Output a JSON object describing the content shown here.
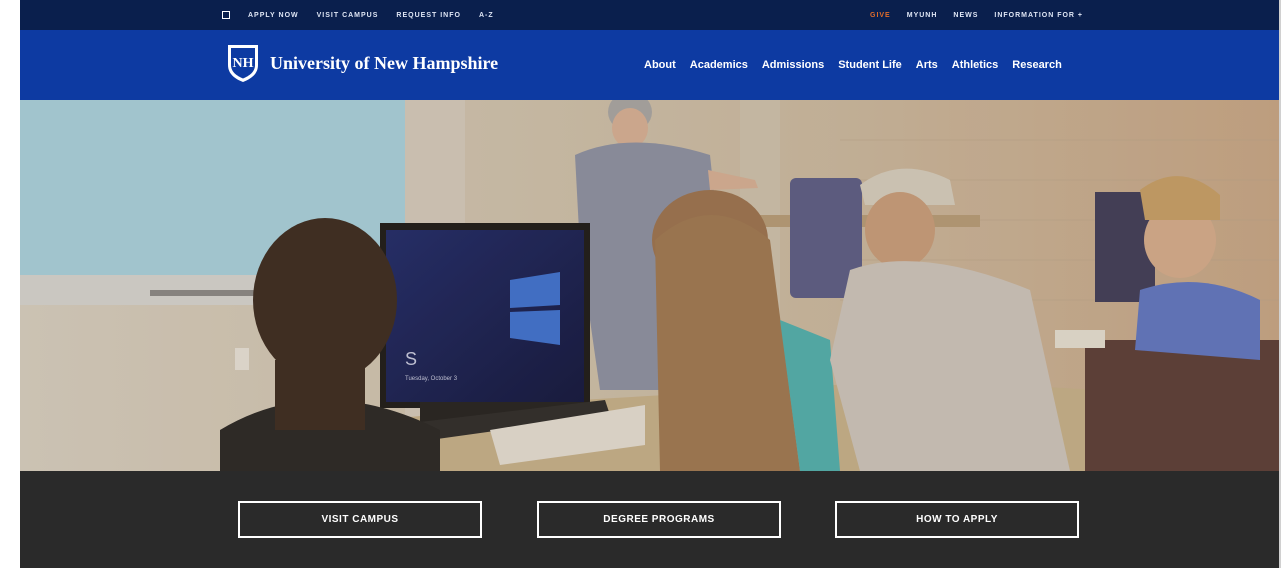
{
  "utility_nav": {
    "left": [
      "APPLY NOW",
      "VISIT CAMPUS",
      "REQUEST INFO",
      "A-Z"
    ],
    "right": [
      "GIVE",
      "MYUNH",
      "NEWS",
      "INFORMATION FOR +"
    ]
  },
  "header": {
    "logo_letters": "NH",
    "site_name": "University of New Hampshire",
    "nav": [
      "About",
      "Academics",
      "Admissions",
      "Student Life",
      "Arts",
      "Athletics",
      "Research"
    ]
  },
  "hero": {
    "screen_text": "S",
    "screen_subtext": "Tuesday, October 3"
  },
  "cta": [
    "VISIT CAMPUS",
    "DEGREE PROGRAMS",
    "HOW TO APPLY"
  ],
  "colors": {
    "utility_bg": "#0a1f4d",
    "brand_blue": "#0d3aa2",
    "give_accent": "#e06c2b",
    "cta_bg": "#2a2a2a"
  },
  "icons": {
    "utility_square": "square-outline-icon",
    "logo": "unh-shield-logo"
  }
}
